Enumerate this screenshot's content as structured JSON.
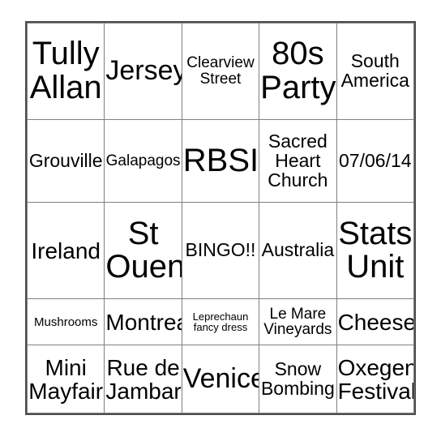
{
  "card": {
    "type": "bingo-card",
    "rows": 5,
    "columns": 5,
    "background_color": "#ffffff",
    "text_color": "#000000",
    "gridline_color": "#808080",
    "outer_border_color": "#4d4d4d",
    "cells": [
      [
        {
          "text": "Tully\nAllan",
          "size": "fs-xxl"
        },
        {
          "text": "Jersey",
          "size": "fs-xl"
        },
        {
          "text": "Clearview\nStreet",
          "size": "fs-sm"
        },
        {
          "text": "80s\nParty",
          "size": "fs-xxl"
        },
        {
          "text": "South\nAmerica",
          "size": "fs-md"
        }
      ],
      [
        {
          "text": "Grouville",
          "size": "fs-md"
        },
        {
          "text": "Galapagos",
          "size": "fs-sm"
        },
        {
          "text": "RBSI",
          "size": "fs-xxl"
        },
        {
          "text": "Sacred\nHeart\nChurch",
          "size": "fs-md"
        },
        {
          "text": "07/06/14",
          "size": "fs-md"
        }
      ],
      [
        {
          "text": "Ireland",
          "size": "fs-lg"
        },
        {
          "text": "St\nOuen",
          "size": "fs-xxl"
        },
        {
          "text": "BINGO!!",
          "size": "fs-md"
        },
        {
          "text": "Australia",
          "size": "fs-md"
        },
        {
          "text": "Stats\nUnit",
          "size": "fs-xxl"
        }
      ],
      [
        {
          "text": "Mushrooms",
          "size": "fs-xs"
        },
        {
          "text": "Montreal",
          "size": "fs-lg"
        },
        {
          "text": "Leprechaun\nfancy dress",
          "size": "fs-xxs"
        },
        {
          "text": "Le Mare\nVineyards",
          "size": "fs-sm"
        },
        {
          "text": "Cheese",
          "size": "fs-lg"
        }
      ],
      [
        {
          "text": "Mini\nMayfair",
          "size": "fs-lg"
        },
        {
          "text": "Rue de\nJambart",
          "size": "fs-lg"
        },
        {
          "text": "Venice",
          "size": "fs-xl"
        },
        {
          "text": "Snow\nBombing",
          "size": "fs-md"
        },
        {
          "text": "Oxegen\nFestival",
          "size": "fs-lg"
        }
      ]
    ]
  }
}
